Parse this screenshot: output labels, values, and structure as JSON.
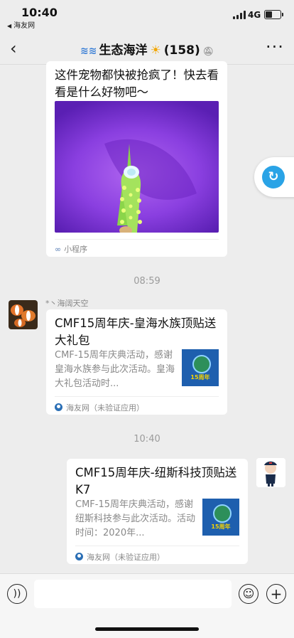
{
  "status_bar": {
    "time": "10:40",
    "back_app": "海友网",
    "network": "4G"
  },
  "nav": {
    "title": "生态海洋",
    "member_count": "(158)"
  },
  "messages": {
    "first": {
      "text": "这件宠物都快被抢疯了！快去看看是什么好物吧～",
      "footer": "小程序"
    },
    "time1": "08:59",
    "second": {
      "sender": "*丶海阔天空",
      "title": "CMF15周年庆-皇海水族顶贴送大礼包",
      "desc": "CMF-15周年庆典活动，感谢皇海水族参与此次活动。皇海大礼包活动时...",
      "thumb_text": "15周年",
      "footer": "海友网（未验证应用）"
    },
    "time2": "10:40",
    "third": {
      "title": "CMF15周年庆-纽斯科技顶贴送K7",
      "desc": "CMF-15周年庆典活动，感谢纽斯科技参与此次活动。活动时间：2020年...",
      "thumb_text": "15周年",
      "footer": "海友网（未验证应用）"
    }
  },
  "icons": {
    "back": "chevron-left-icon",
    "more": "more-icon",
    "voice": "voice-icon",
    "emoji": "emoji-icon",
    "add": "add-icon",
    "float": "refresh-icon"
  },
  "colors": {
    "accent": "#2aa3e6",
    "background": "#ededed",
    "thumb_bg": "#1e5fae"
  }
}
